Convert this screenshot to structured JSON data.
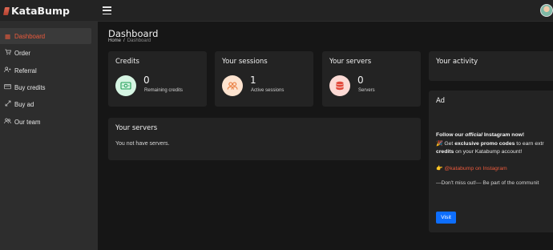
{
  "brand": {
    "name": "KataBump"
  },
  "sidebar": {
    "items": [
      {
        "label": "Dashboard",
        "icon": "dashboard-icon",
        "active": true
      },
      {
        "label": "Order",
        "icon": "cart-icon",
        "active": false
      },
      {
        "label": "Referral",
        "icon": "user-plus-icon",
        "active": false
      },
      {
        "label": "Buy credits",
        "icon": "credit-card-icon",
        "active": false
      },
      {
        "label": "Buy ad",
        "icon": "expand-arrows-icon",
        "active": false
      },
      {
        "label": "Our team",
        "icon": "team-icon",
        "active": false
      }
    ]
  },
  "header": {
    "title": "Dashboard",
    "breadcrumb": {
      "home": "Home",
      "separator": "/",
      "current": "Dashboard"
    }
  },
  "cards": {
    "credits": {
      "title": "Credits",
      "value": "0",
      "label": "Remaining credits",
      "icon": "money-icon"
    },
    "sessions": {
      "title": "Your sessions",
      "value": "1",
      "label": "Active sessions",
      "icon": "users-icon"
    },
    "servers": {
      "title": "Your servers",
      "value": "0",
      "label": "Servers",
      "icon": "database-icon"
    },
    "activity": {
      "title": "Your activity"
    },
    "servers_list": {
      "title": "Your servers",
      "empty_text": "You not have servers."
    },
    "ad": {
      "title": "Ad",
      "line1_pre": "Follow our ",
      "line1_em": "official",
      "line1_post": " Instagram now!",
      "line2_emoji": "🎉",
      "line2_pre": " Get ",
      "line2_bold": "exclusive promo codes",
      "line2_post": " to earn extr",
      "line3_bold": "credits",
      "line3_post": " on your Katabump account!",
      "link_emoji": "👉",
      "link_text": "@katabump on Instagram",
      "note": "—Don't miss out!— Be part of the communit",
      "button": "Visit"
    }
  },
  "colors": {
    "accent": "#ec5a3c",
    "primary_button": "#0d6efd",
    "sidebar_bg": "#2d2d2d",
    "card_bg": "#232323",
    "page_bg": "#161616"
  }
}
